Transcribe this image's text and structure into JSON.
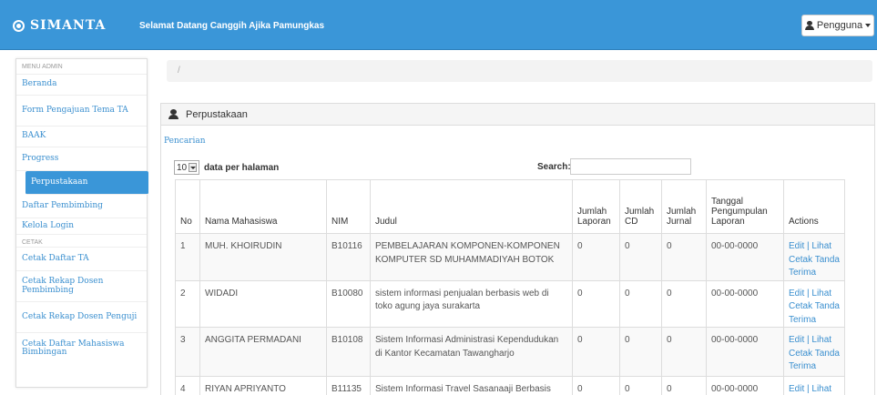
{
  "navbar": {
    "brand": "SIMANTA",
    "welcome": "Selamat Datang Canggih Ajika Pamungkas",
    "user_menu": "Pengguna",
    "accent": "#3a96d8"
  },
  "sidebar": {
    "section_admin": "MENU ADMIN",
    "section_cetak": "CETAK",
    "items": [
      {
        "label": "Beranda"
      },
      {
        "label": "Form Pengajuan Tema TA"
      },
      {
        "label": "BAAK"
      },
      {
        "label": "Progress"
      },
      {
        "label": "Perpustakaan"
      },
      {
        "label": "Daftar Pembimbing"
      },
      {
        "label": "Kelola Login"
      }
    ],
    "cetak_items": [
      {
        "label": "Cetak Daftar TA"
      },
      {
        "label": "Cetak Rekap Dosen Pembimbing"
      },
      {
        "label": "Cetak Rekap Dosen Penguji"
      },
      {
        "label": "Cetak Daftar Mahasiswa Bimbingan"
      }
    ]
  },
  "breadcrumb": "/",
  "panel": {
    "title": "Perpustakaan",
    "search_link": "Pencarian",
    "page_size": "10",
    "page_size_suffix": "data per halaman",
    "search_label": "Search:",
    "search_value": ""
  },
  "table": {
    "headers": [
      "No",
      "Nama Mahasiswa",
      "NIM",
      "Judul",
      "Jumlah Laporan",
      "Jumlah CD",
      "Jumlah Jurnal",
      "Tanggal Pengumpulan Laporan",
      "Actions"
    ],
    "rows": [
      {
        "no": "1",
        "nama": "MUH. KHOIRUDIN",
        "nim": "B10116",
        "judul": "PEMBELAJARAN KOMPONEN-KOMPONEN KOMPUTER SD MUHAMMADIYAH BOTOK",
        "laporan": "0",
        "cd": "0",
        "jurnal": "0",
        "tanggal": "00-00-0000",
        "actions": "Edit | Lihat Cetak Tanda Terima"
      },
      {
        "no": "2",
        "nama": "WIDADI",
        "nim": "B10080",
        "judul": "sistem informasi penjualan berbasis web di toko agung jaya surakarta",
        "laporan": "0",
        "cd": "0",
        "jurnal": "0",
        "tanggal": "00-00-0000",
        "actions": "Edit | Lihat Cetak Tanda Terima"
      },
      {
        "no": "3",
        "nama": "ANGGITA PERMADANI",
        "nim": "B10108",
        "judul": "Sistem Informasi Administrasi Kependudukan di Kantor Kecamatan Tawangharjo",
        "laporan": "0",
        "cd": "0",
        "jurnal": "0",
        "tanggal": "00-00-0000",
        "actions": "Edit | Lihat Cetak Tanda Terima"
      },
      {
        "no": "4",
        "nama": "RIYAN APRIYANTO",
        "nim": "B11135",
        "judul": "Sistem Informasi Travel Sasanaaji Berbasis",
        "laporan": "0",
        "cd": "0",
        "jurnal": "0",
        "tanggal": "00-00-0000",
        "actions": "Edit | Lihat"
      }
    ]
  }
}
